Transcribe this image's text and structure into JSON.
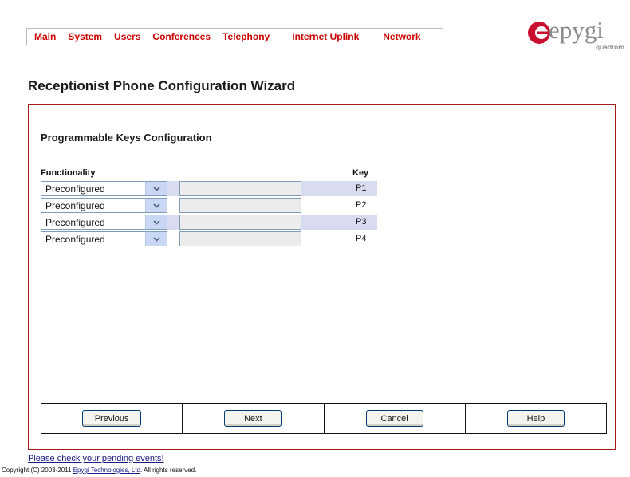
{
  "menu": {
    "items": [
      "Main",
      "System",
      "Users",
      "Conferences",
      "Telephony",
      "Internet Uplink",
      "Network"
    ]
  },
  "logo": {
    "word": "epygi",
    "sub": "quadrom"
  },
  "page_title": "Receptionist Phone Configuration Wizard",
  "section_title": "Programmable Keys Configuration",
  "table": {
    "col_functionality": "Functionality",
    "col_key": "Key",
    "rows": [
      {
        "functionality": "Preconfigured",
        "value": "",
        "key": "P1"
      },
      {
        "functionality": "Preconfigured",
        "value": "",
        "key": "P2"
      },
      {
        "functionality": "Preconfigured",
        "value": "",
        "key": "P3"
      },
      {
        "functionality": "Preconfigured",
        "value": "",
        "key": "P4"
      }
    ]
  },
  "buttons": {
    "previous": "Previous",
    "next": "Next",
    "cancel": "Cancel",
    "help": "Help"
  },
  "footer": {
    "pending": "Please check your pending events!",
    "copyright_prefix": "Copyright (C) 2003-2011 ",
    "copyright_link": "Epygi Technologies, Ltd",
    "copyright_suffix": ". All rights reserved."
  },
  "colors": {
    "menu_text": "#cc0000",
    "panel_border": "#a31a1a",
    "row_shade": "#d9dcf0"
  }
}
